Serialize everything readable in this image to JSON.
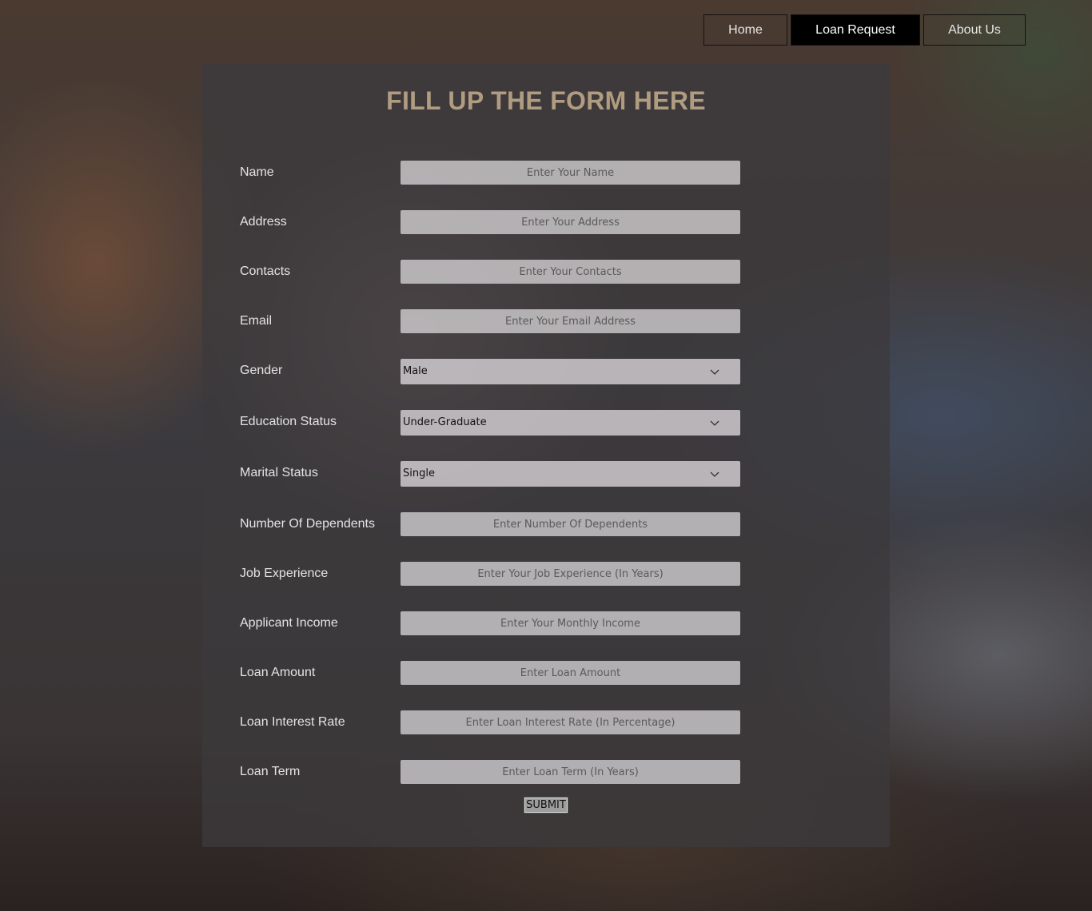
{
  "nav": {
    "home": "Home",
    "loan_request": "Loan Request",
    "about_us": "About Us"
  },
  "form": {
    "title": "FILL UP THE FORM HERE",
    "fields": {
      "name": {
        "label": "Name",
        "placeholder": "Enter Your Name"
      },
      "address": {
        "label": "Address",
        "placeholder": "Enter Your Address"
      },
      "contacts": {
        "label": "Contacts",
        "placeholder": "Enter Your Contacts"
      },
      "email": {
        "label": "Email",
        "placeholder": "Enter Your Email Address"
      },
      "gender": {
        "label": "Gender",
        "value": "Male"
      },
      "education": {
        "label": "Education Status",
        "value": "Under-Graduate"
      },
      "marital": {
        "label": "Marital Status",
        "value": "Single"
      },
      "dependents": {
        "label": "Number Of Dependents",
        "placeholder": "Enter Number Of Dependents"
      },
      "experience": {
        "label": "Job Experience",
        "placeholder": "Enter Your Job Experience (In Years)"
      },
      "income": {
        "label": "Applicant Income",
        "placeholder": "Enter Your Monthly Income"
      },
      "loan_amount": {
        "label": "Loan Amount",
        "placeholder": "Enter Loan Amount"
      },
      "interest_rate": {
        "label": "Loan Interest Rate",
        "placeholder": "Enter Loan Interest Rate (In Percentage)"
      },
      "loan_term": {
        "label": "Loan Term",
        "placeholder": "Enter Loan Term (In Years)"
      }
    },
    "submit_label": "SUBMIT"
  },
  "colors": {
    "title": "#b09c80",
    "active_nav_bg": "#000000",
    "panel_bg": "#3c3a3c"
  },
  "icons": {
    "select_arrow": "chevron-down-icon"
  }
}
